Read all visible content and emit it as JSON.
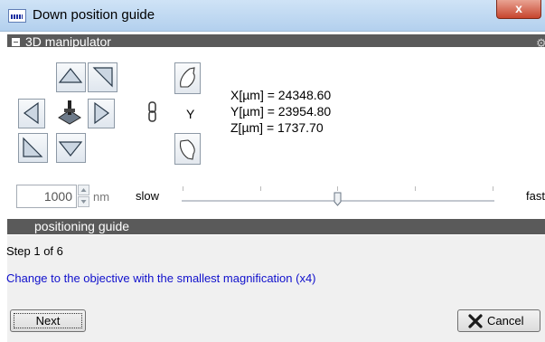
{
  "window": {
    "title": "Down position guide",
    "close_glyph": "x"
  },
  "manipulator": {
    "section_title": "3D manipulator",
    "axis_label": "Y",
    "coords": {
      "x": "X[µm] = 24348.60",
      "y": "Y[µm] = 23954.80",
      "z": "Z[µm] = 1737.70"
    },
    "step_value": "1000",
    "step_unit": "nm",
    "speed_slow_label": "slow",
    "speed_fast_label": "fast",
    "speed_level": 0.5,
    "icons": {
      "up": "arrow-up-icon",
      "down": "arrow-down-icon",
      "left": "arrow-left-icon",
      "right": "arrow-right-icon",
      "diag_up_right": "diagonal-up-right-icon",
      "diag_down_left": "diagonal-down-left-icon",
      "center": "stage-icon",
      "link": "chain-link-icon",
      "rotate_up": "rotate-up-icon",
      "rotate_down": "rotate-down-icon"
    }
  },
  "guide": {
    "section_title": "positioning guide",
    "step_text": "Step 1 of 6",
    "instruction": "Change to the objective with the smallest magnification (x4)",
    "next_label": "Next",
    "cancel_label": "Cancel",
    "instruction_color": "#1010cc"
  }
}
